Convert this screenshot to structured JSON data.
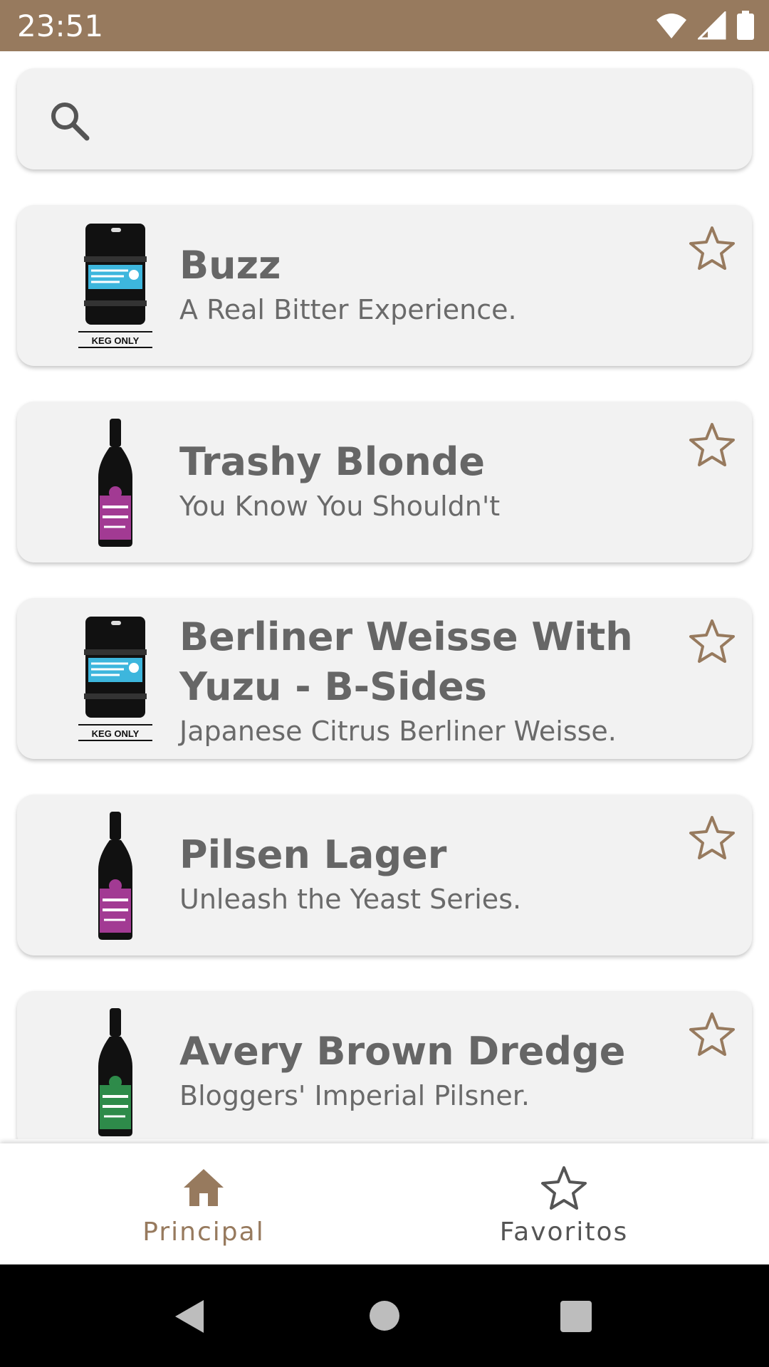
{
  "status": {
    "time": "23:51"
  },
  "search": {
    "placeholder": "",
    "value": ""
  },
  "beers": [
    {
      "name": "Buzz",
      "tagline": "A Real Bitter Experience.",
      "image": "keg"
    },
    {
      "name": "Trashy Blonde",
      "tagline": "You Know You Shouldn't",
      "image": "bottle-purple"
    },
    {
      "name": "Berliner Weisse With Yuzu - B-Sides",
      "tagline": "Japanese Citrus Berliner Weisse.",
      "image": "keg"
    },
    {
      "name": "Pilsen Lager",
      "tagline": "Unleash the Yeast Series.",
      "image": "bottle-purple"
    },
    {
      "name": "Avery Brown Dredge",
      "tagline": "Bloggers' Imperial Pilsner.",
      "image": "bottle-green"
    }
  ],
  "keg_label": "KEG ONLY",
  "nav": {
    "home_label": "Principal",
    "favorites_label": "Favoritos"
  },
  "colors": {
    "accent": "#977a5e",
    "text": "#666666",
    "card": "#f2f2f2"
  }
}
